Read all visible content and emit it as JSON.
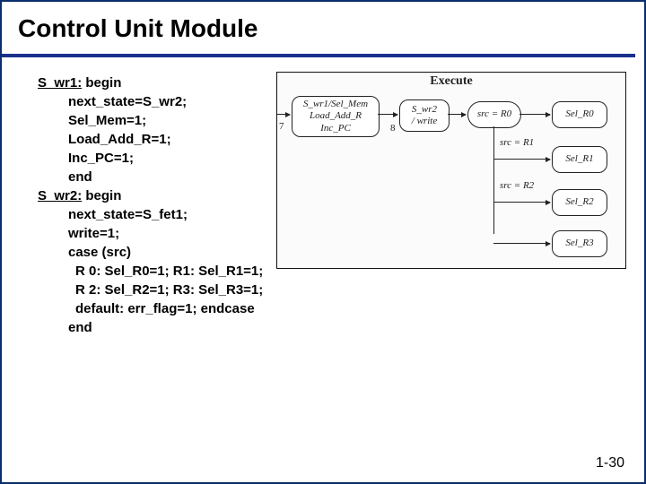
{
  "title": "Control Unit Module",
  "code": {
    "state1": {
      "name": "S_wr1:",
      "begin": " begin"
    },
    "s1_lines": [
      "next_state=S_wr2;",
      "Sel_Mem=1;",
      "Load_Add_R=1;",
      "Inc_PC=1;",
      "end"
    ],
    "state2": {
      "name": "S_wr2:",
      "begin": " begin"
    },
    "s2_lines": [
      "next_state=S_fet1;",
      "write=1;",
      "case (src)"
    ],
    "s2_case": [
      "R 0: Sel_R0=1; R1: Sel_R1=1;",
      "R 2: Sel_R2=1; R3: Sel_R3=1;",
      "default: err_flag=1; endcase"
    ],
    "s2_end": "end"
  },
  "diagram": {
    "header": "Execute",
    "in_label": "7",
    "box1": "S_wr1/Sel_Mem\nLoad_Add_R\nInc_PC",
    "box2": "S_wr2\n/ write",
    "mid_label": "8",
    "decision": "src = R0",
    "r0": "Sel_R0",
    "r1_cond": "src = R1",
    "r1": "Sel_R1",
    "r2_cond": "src = R2",
    "r2": "Sel_R2",
    "r3": "Sel_R3"
  },
  "page": "1-30"
}
